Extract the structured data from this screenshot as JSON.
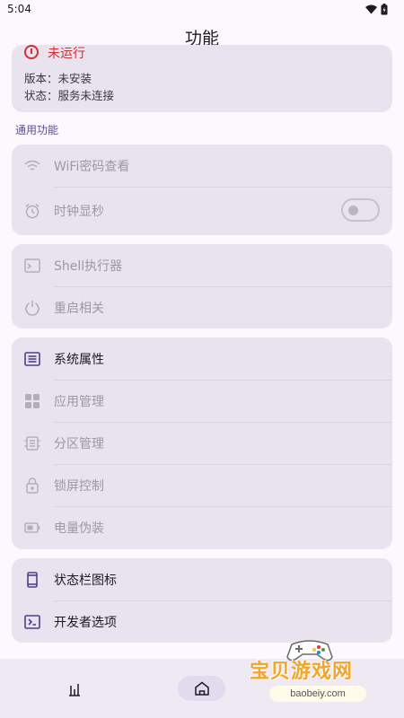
{
  "status_bar": {
    "time": "5:04"
  },
  "header": {
    "title": "功能"
  },
  "status_card": {
    "state_text": "未运行",
    "version_line": "版本：未安装",
    "service_line": "状态：服务未连接"
  },
  "section": {
    "general_title": "通用功能"
  },
  "group1": [
    {
      "label": "WiFi密码查看",
      "icon": "wifi-icon"
    },
    {
      "label": "时钟显秒",
      "icon": "alarm-icon",
      "toggle_on": false
    }
  ],
  "group2": [
    {
      "label": "Shell执行器",
      "icon": "terminal-icon"
    },
    {
      "label": "重启相关",
      "icon": "power-icon"
    }
  ],
  "group3": [
    {
      "label": "系统属性",
      "icon": "list-icon"
    },
    {
      "label": "应用管理",
      "icon": "apps-grid-icon"
    },
    {
      "label": "分区管理",
      "icon": "chip-icon"
    },
    {
      "label": "锁屏控制",
      "icon": "lock-icon"
    },
    {
      "label": "电量伪装",
      "icon": "battery-icon"
    }
  ],
  "group4": [
    {
      "label": "状态栏图标",
      "icon": "phone-icon"
    },
    {
      "label": "开发者选项",
      "icon": "code-icon"
    }
  ],
  "nav": {
    "items": [
      "recents-icon",
      "home-icon"
    ]
  },
  "watermark": {
    "title": "宝贝游戏网",
    "subtitle": "baobeiy.com"
  },
  "colors": {
    "accent": "#5b4ca0",
    "card": "#e8e3ef",
    "error": "#d32f2f"
  }
}
